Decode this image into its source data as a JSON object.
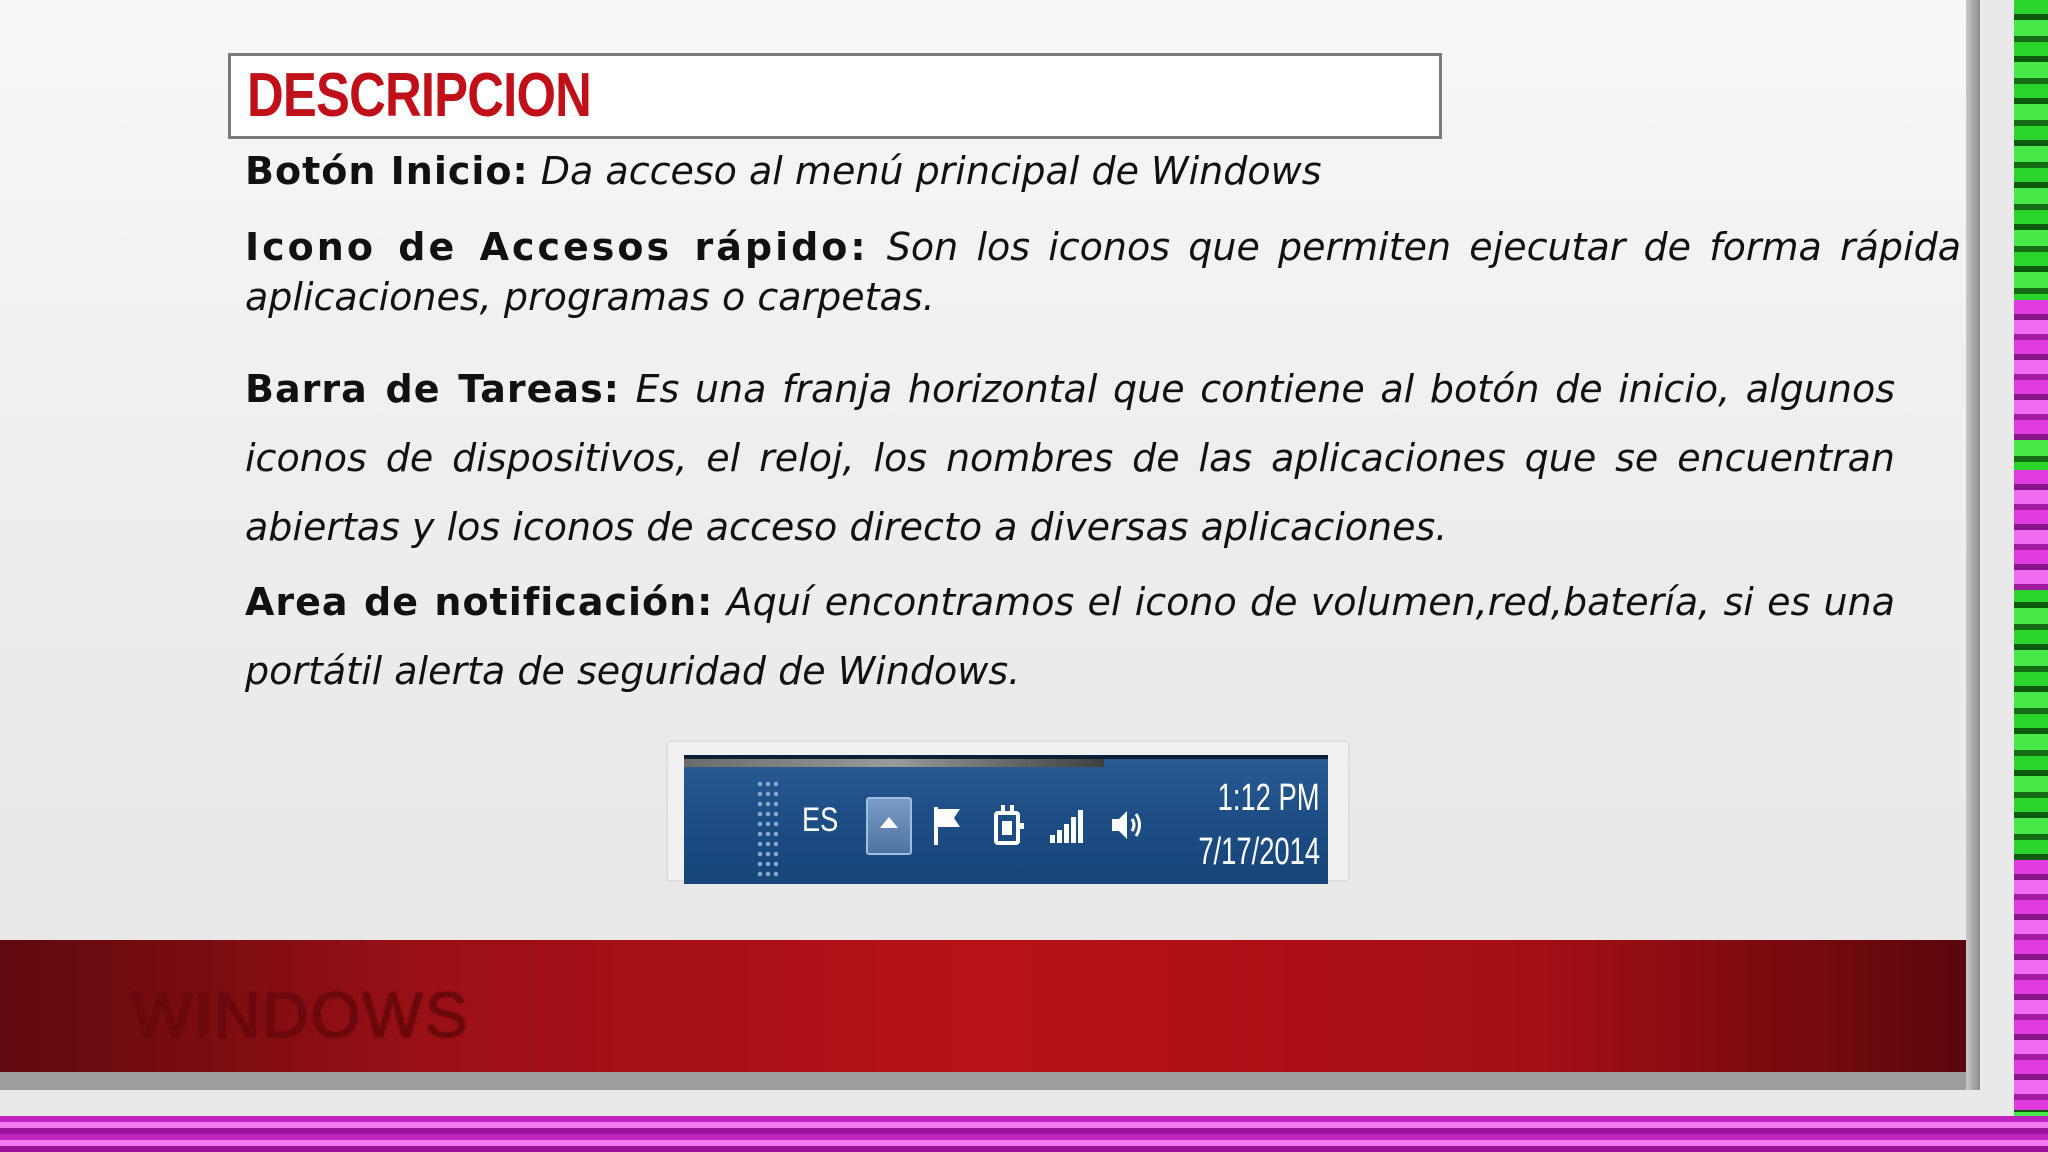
{
  "slide": {
    "title": "DESCRIPCION",
    "footer_label": "WINDOWS"
  },
  "items": [
    {
      "term": "Botón Inicio:",
      "description": "Da acceso al menú principal de Windows"
    },
    {
      "term": "Icono de Accesos rápido:",
      "description": "Son los iconos que permiten ejecutar de forma rápida aplicaciones, programas o carpetas."
    },
    {
      "term": "Barra de Tareas:",
      "description": "Es una franja horizontal que contiene al botón de inicio, algunos iconos de dispositivos, el reloj, los nombres de las aplicaciones que se encuentran abiertas y los iconos de acceso directo a diversas aplicaciones."
    },
    {
      "term": "Area de notificación:",
      "description": "Aquí encontramos el icono de volumen,red,batería, si es una portátil alerta de seguridad de Windows."
    }
  ],
  "taskbar": {
    "language": "ES",
    "time": "1:12 PM",
    "date": "7/17/2014",
    "icons": [
      "show-hidden-icons",
      "action-center-flag-icon",
      "power-plug-icon",
      "network-signal-icon",
      "volume-icon"
    ]
  },
  "colors": {
    "title_red": "#c0101a",
    "footer_red": "#b71218",
    "taskbar_blue": "#1e4f86"
  }
}
